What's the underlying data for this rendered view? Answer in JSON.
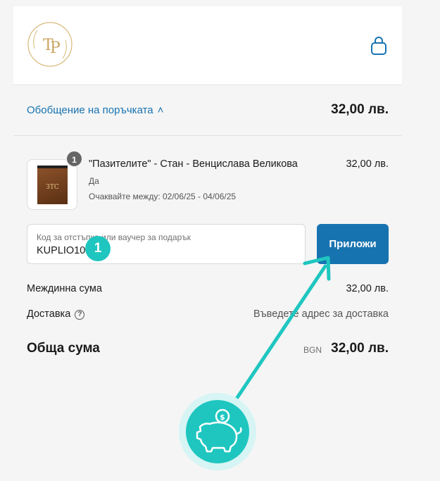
{
  "header": {
    "logo_icon": "tp-monogram-logo",
    "cart_icon": "shopping-bag-icon"
  },
  "summary_toggle": {
    "label": "Обобщение на поръчката",
    "chevron": "˄",
    "total": "32,00 лв."
  },
  "cart": {
    "items": [
      {
        "quantity": "1",
        "title": "\"Пазителите\" - Стан - Венцислава Великова",
        "variant": "Да",
        "delivery_estimate": "Очаквайте между: 02/06/25 - 04/06/25",
        "price": "32,00 лв.",
        "cover_text": "ЗТС"
      }
    ]
  },
  "discount": {
    "label": "Код за отстъпка или ваучер за подарък",
    "value": "KUPLIO10",
    "apply_label": "Приложи"
  },
  "totals": {
    "subtotal_label": "Междинна сума",
    "subtotal_value": "32,00 лв.",
    "shipping_label": "Доставка",
    "shipping_value": "Въведете адрес за доставка",
    "total_label": "Обща сума",
    "currency": "BGN",
    "total_value": "32,00 лв."
  },
  "annotation": {
    "step_number": "1",
    "icon": "piggy-bank-coin-icon",
    "accent_color": "#1fc6c0"
  },
  "colors": {
    "link": "#1773b0",
    "button": "#1773b0",
    "background": "#f5f5f5"
  }
}
